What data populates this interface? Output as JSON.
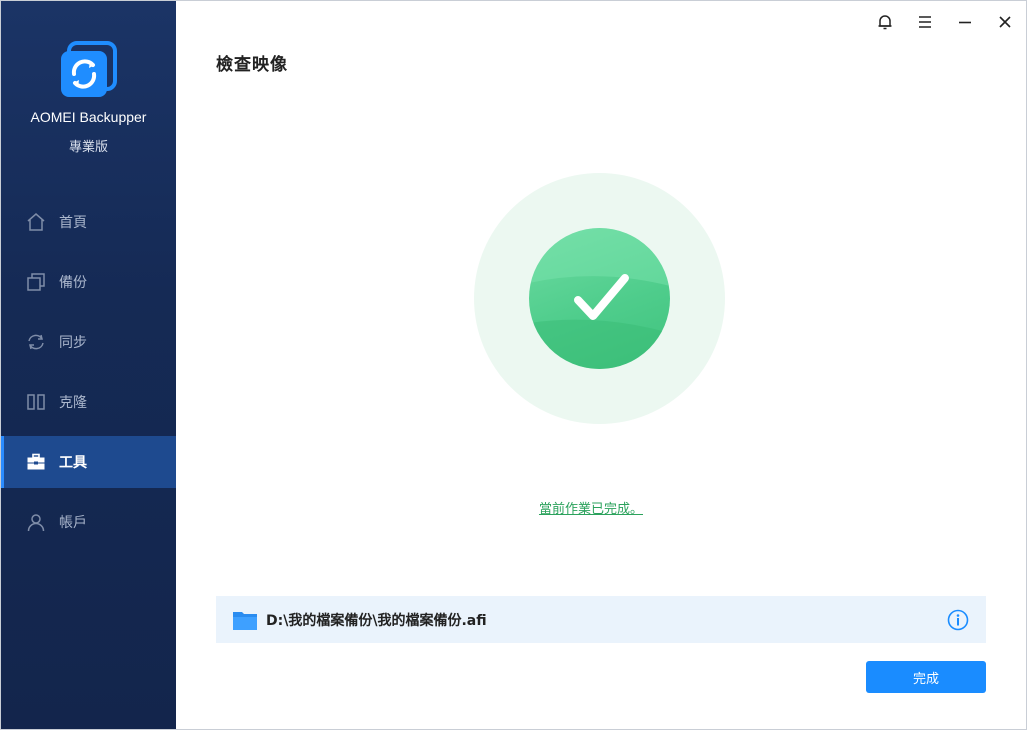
{
  "app": {
    "name": "AOMEI Backupper",
    "edition": "專業版"
  },
  "sidebar": {
    "items": [
      {
        "label": "首頁",
        "icon": "home-icon"
      },
      {
        "label": "備份",
        "icon": "backup-icon"
      },
      {
        "label": "同步",
        "icon": "sync-icon"
      },
      {
        "label": "克隆",
        "icon": "clone-icon"
      },
      {
        "label": "工具",
        "icon": "toolbox-icon",
        "active": true
      },
      {
        "label": "帳戶",
        "icon": "user-icon"
      }
    ]
  },
  "titlebar": {
    "icons": [
      "bell-icon",
      "menu-icon",
      "minimize-icon",
      "close-icon"
    ]
  },
  "main": {
    "title": "檢查映像",
    "status_text": "當前作業已完成。",
    "file_path": "D:\\我的檔案備份\\我的檔案備份.afi",
    "done_label": "完成"
  },
  "colors": {
    "sidebar_bg": "#152a55",
    "active_item": "#1e4a8f",
    "accent": "#1a8cff",
    "success": "#4fcd8c",
    "file_bar_bg": "#eaf3fc"
  }
}
